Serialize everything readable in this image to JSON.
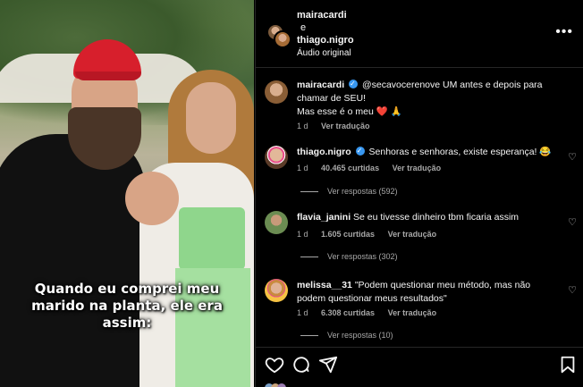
{
  "media": {
    "caption": "Quando eu comprei meu marido na planta, ele era assim:"
  },
  "header": {
    "user1": "mairacardi",
    "connector": "e",
    "user2": "thiago.nigro",
    "audio": "Áudio original",
    "more_icon": "more-horizontal-icon"
  },
  "comments": [
    {
      "user": "mairacardi",
      "verified": true,
      "text": "@secavocerenove UM antes e depois para chamar de SEU!",
      "text2": "Mas esse é o meu ❤️ 🙏",
      "time": "1 d",
      "translate": "Ver tradução"
    },
    {
      "user": "thiago.nigro",
      "verified": true,
      "text": "Senhoras e senhoras, existe esperança! 😂",
      "time": "1 d",
      "likes": "40.465 curtidas",
      "translate": "Ver tradução",
      "replies": "Ver respostas (592)"
    },
    {
      "user": "flavia_janini",
      "text": "Se eu tivesse dinheiro tbm ficaria assim",
      "time": "1 d",
      "likes": "1.605 curtidas",
      "translate": "Ver tradução",
      "replies": "Ver respostas (302)"
    },
    {
      "user": "melissa__31",
      "text": "\"Podem questionar meu método, mas não podem questionar meus resultados\"",
      "time": "1 d",
      "likes": "6.308 curtidas",
      "translate": "Ver tradução",
      "replies": "Ver respostas (10)"
    }
  ],
  "actions": {
    "like_icon": "heart-icon",
    "comment_icon": "comment-icon",
    "share_icon": "send-icon",
    "save_icon": "bookmark-icon"
  }
}
